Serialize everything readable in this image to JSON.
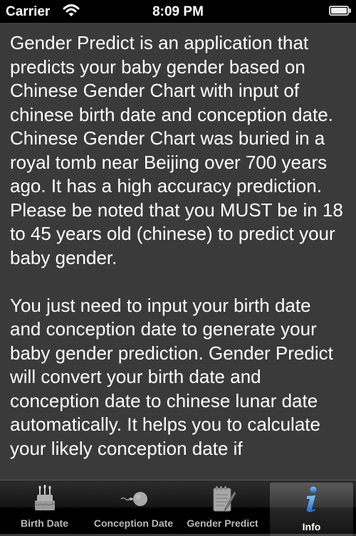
{
  "status_bar": {
    "carrier": "Carrier",
    "time": "8:09 PM",
    "wifi_icon": "wifi-icon",
    "battery_icon": "battery-icon"
  },
  "content": {
    "paragraphs": [
      "Gender Predict is an application that predicts your baby gender based on Chinese Gender Chart with input of chinese birth date and conception date. Chinese Gender Chart was buried in a royal tomb near Beijing over 700 years ago. It has a high accuracy prediction. Please be noted that you MUST be in 18 to 45 years old (chinese) to predict your baby gender.",
      "You just need to input your birth date and conception date to generate your baby gender prediction. Gender Predict will convert your birth date and conception date to chinese lunar date automatically. It helps you to calculate your likely conception date if"
    ]
  },
  "tab_bar": {
    "active_index": 3,
    "tabs": [
      {
        "label": "Birth Date",
        "icon": "birthday-cake-icon"
      },
      {
        "label": "Conception Date",
        "icon": "sperm-egg-icon"
      },
      {
        "label": "Gender Predict",
        "icon": "notepad-pen-icon"
      },
      {
        "label": "Info",
        "icon": "info-icon"
      }
    ]
  },
  "colors": {
    "background": "#3a3a3a",
    "text": "#ffffff",
    "status_bar": "#000000",
    "info_icon": "#3f8fe0"
  }
}
